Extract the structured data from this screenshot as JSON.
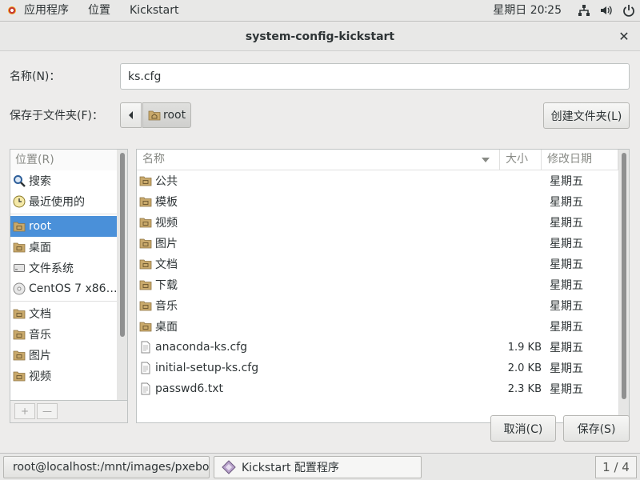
{
  "topbar": {
    "apps_label": "应用程序",
    "places_label": "位置",
    "app_label": "Kickstart",
    "clock": "星期日 20∶25"
  },
  "dialog": {
    "title": "system-config-kickstart",
    "name_label": "名称(N)：",
    "name_value": "ks.cfg",
    "save_in_label": "保存于文件夹(F)：",
    "path_current": "root",
    "create_folder_label": "创建文件夹(L)",
    "places_header": "位置(R)",
    "places": [
      {
        "label": "搜索",
        "icon": "search-icon"
      },
      {
        "label": "最近使用的",
        "icon": "recent-icon"
      },
      {
        "label": "root",
        "icon": "home-folder-icon",
        "selected": true
      },
      {
        "label": "桌面",
        "icon": "desktop-folder-icon"
      },
      {
        "label": "文件系统",
        "icon": "drive-icon"
      },
      {
        "label": "CentOS 7 x86…",
        "icon": "disc-icon"
      },
      {
        "label": "文档",
        "icon": "documents-folder-icon"
      },
      {
        "label": "音乐",
        "icon": "music-folder-icon"
      },
      {
        "label": "图片",
        "icon": "pictures-folder-icon"
      },
      {
        "label": "视频",
        "icon": "videos-folder-icon"
      }
    ],
    "columns": {
      "name": "名称",
      "size": "大小",
      "date": "修改日期"
    },
    "files": [
      {
        "name": "公共",
        "size": "",
        "date": "星期五",
        "type": "folder"
      },
      {
        "name": "模板",
        "size": "",
        "date": "星期五",
        "type": "folder"
      },
      {
        "name": "视频",
        "size": "",
        "date": "星期五",
        "type": "folder"
      },
      {
        "name": "图片",
        "size": "",
        "date": "星期五",
        "type": "folder"
      },
      {
        "name": "文档",
        "size": "",
        "date": "星期五",
        "type": "folder"
      },
      {
        "name": "下载",
        "size": "",
        "date": "星期五",
        "type": "folder"
      },
      {
        "name": "音乐",
        "size": "",
        "date": "星期五",
        "type": "folder"
      },
      {
        "name": "桌面",
        "size": "",
        "date": "星期五",
        "type": "folder"
      },
      {
        "name": "anaconda-ks.cfg",
        "size": "1.9 KB",
        "date": "星期五",
        "type": "file"
      },
      {
        "name": "initial-setup-ks.cfg",
        "size": "2.0 KB",
        "date": "星期五",
        "type": "file"
      },
      {
        "name": "passwd6.txt",
        "size": "2.3 KB",
        "date": "星期五",
        "type": "file"
      }
    ],
    "cancel_label": "取消(C)",
    "save_label": "保存(S)"
  },
  "taskbar": {
    "terminal_label": "root@localhost:/mnt/images/pxeboot",
    "kickstart_label": "Kickstart 配置程序",
    "workspace": "1 / 4"
  },
  "colors": {
    "selection": "#4a90d9",
    "folder": "#c9a96b"
  }
}
